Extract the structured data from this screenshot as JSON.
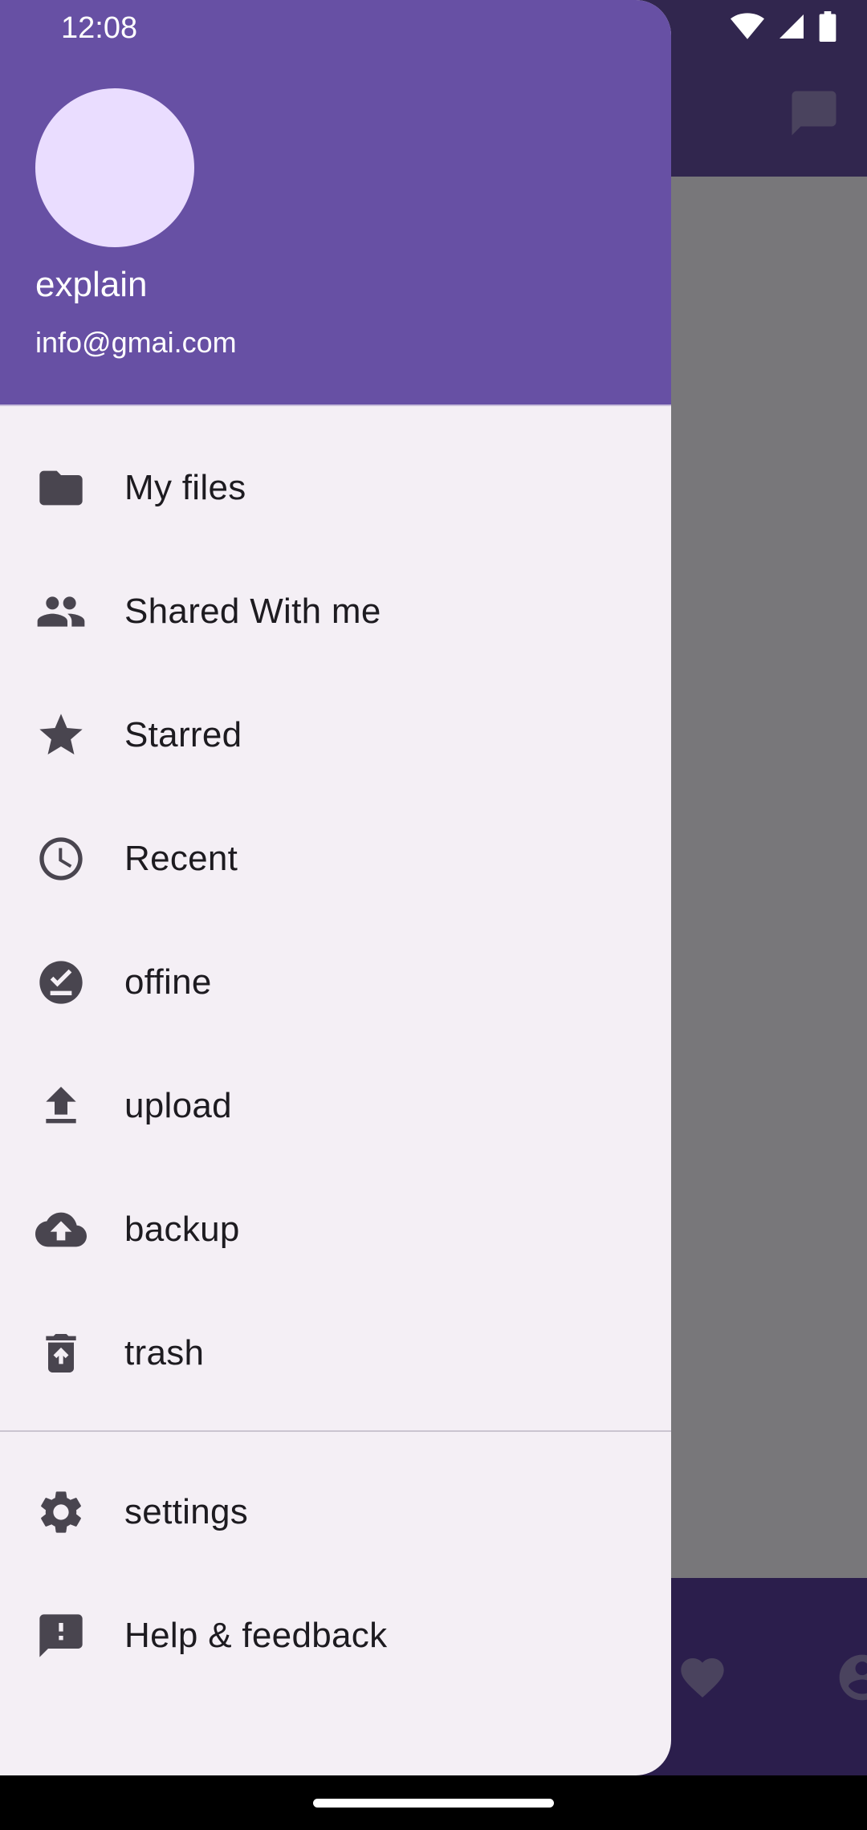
{
  "status_bar": {
    "time": "12:08"
  },
  "drawer": {
    "header": {
      "name": "explain",
      "email": "info@gmai.com"
    },
    "items": [
      {
        "label": "My files",
        "icon": "folder-icon"
      },
      {
        "label": "Shared With me",
        "icon": "people-icon"
      },
      {
        "label": "Starred",
        "icon": "star-icon"
      },
      {
        "label": "Recent",
        "icon": "clock-icon"
      },
      {
        "label": "offine",
        "icon": "offline-check-icon"
      },
      {
        "label": "upload",
        "icon": "upload-icon"
      },
      {
        "label": "backup",
        "icon": "cloud-upload-icon"
      },
      {
        "label": "trash",
        "icon": "trash-icon"
      }
    ],
    "secondary_items": [
      {
        "label": "settings",
        "icon": "gear-icon"
      },
      {
        "label": "Help & feedback",
        "icon": "feedback-icon"
      }
    ]
  },
  "colors": {
    "primary": "#6750a4",
    "drawer_bg": "#f4eff5",
    "icon": "#49454f",
    "text": "#1d1b20"
  }
}
